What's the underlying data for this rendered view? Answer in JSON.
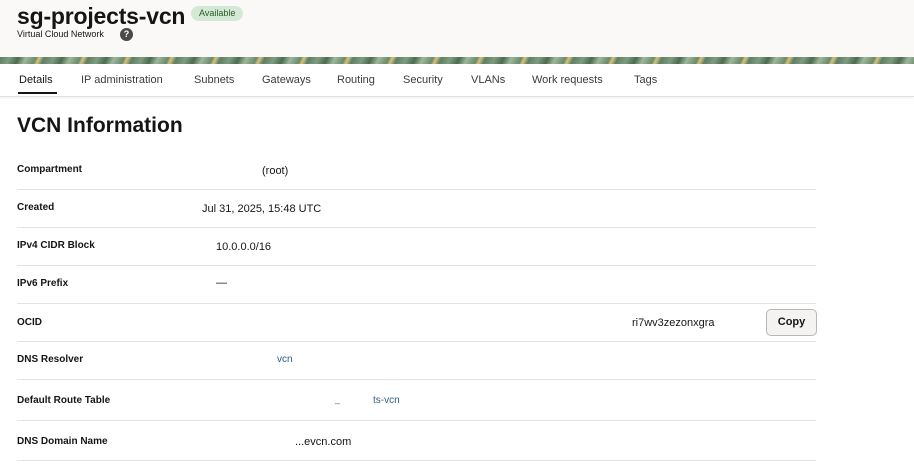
{
  "header": {
    "title": "sg-projects-vcn",
    "status_badge": "Available",
    "subtitle": "Virtual Cloud Network",
    "help_glyph": "?"
  },
  "tabs": [
    {
      "label": "Details",
      "active": true
    },
    {
      "label": "IP administration",
      "active": false
    },
    {
      "label": "Subnets",
      "active": false
    },
    {
      "label": "Gateways",
      "active": false
    },
    {
      "label": "Routing",
      "active": false
    },
    {
      "label": "Security",
      "active": false
    },
    {
      "label": "VLANs",
      "active": false
    },
    {
      "label": "Work requests",
      "active": false
    },
    {
      "label": "Tags",
      "active": false
    }
  ],
  "section": {
    "title": "VCN Information"
  },
  "fields": [
    {
      "label": "Compartment",
      "value": "(root)"
    },
    {
      "label": "Created",
      "value": "Jul 31, 2025, 15:48 UTC"
    },
    {
      "label": "IPv4 CIDR Block",
      "value": "10.0.0.0/16"
    },
    {
      "label": "IPv6 Prefix",
      "value": "—"
    },
    {
      "label": "OCID",
      "value": "ri7wv3zezonxgra",
      "action": "Copy"
    },
    {
      "label": "DNS Resolver",
      "value": "vcn"
    },
    {
      "label": "Default Route Table",
      "value": "ts-vcn",
      "value_prefix": "_"
    },
    {
      "label": "DNS Domain Name",
      "value": "...evcn.com"
    }
  ],
  "colors": {
    "badge_bg": "#d4e9d3",
    "link": "#2d5f86",
    "border": "#e6e3df"
  }
}
